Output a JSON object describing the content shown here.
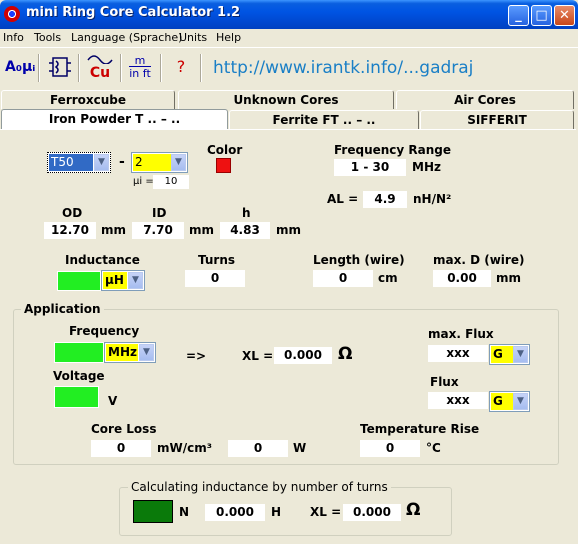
{
  "window": {
    "title": "mini Ring Core Calculator 1.2",
    "min": "_",
    "max": "□",
    "close": "✕"
  },
  "menu": [
    "Info",
    "Tools",
    "Language (Sprache)",
    "Units",
    "Help"
  ],
  "toolbar": {
    "btn1": "A₀μᵢ",
    "btn3": "Cu",
    "btn4_top": "m",
    "btn4_bottom": "in ft",
    "btn5": "?",
    "url": "http://www.irantk.info/...gadraj"
  },
  "tabs_row1": [
    "Ferroxcube",
    "Unknown Cores",
    "Air Cores"
  ],
  "tabs_row2": [
    "Iron Powder T .. – ..",
    "Ferrite FT .. – ..",
    "SIFFERIT"
  ],
  "core": {
    "size_value": "T50",
    "dash": "-",
    "material_value": "2",
    "mu_label": "µi =",
    "mu_value": "10",
    "color_label": "Color",
    "color": "#ee1111",
    "freq_range_label": "Frequency Range",
    "freq_range_value": "1 - 30",
    "freq_range_unit": "MHz",
    "al_label": "AL =",
    "al_value": "4.9",
    "al_unit": "nH/N²",
    "od_label": "OD",
    "od_value": "12.70",
    "od_unit": "mm",
    "id_label": "ID",
    "id_value": "7.70",
    "id_unit": "mm",
    "h_label": "h",
    "h_value": "4.83",
    "h_unit": "mm"
  },
  "winding": {
    "inductance_label": "Inductance",
    "inductance_unit": "µH",
    "turns_label": "Turns",
    "turns_value": "0",
    "length_label": "Length (wire)",
    "length_value": "0",
    "length_unit": "cm",
    "maxd_label": "max. D (wire)",
    "maxd_value": "0.00",
    "maxd_unit": "mm"
  },
  "application": {
    "title": "Application",
    "frequency_label": "Frequency",
    "frequency_unit": "MHz",
    "arrow": "=>",
    "xl_label": "XL =",
    "xl_value": "0.000",
    "ohm": "Ω",
    "voltage_label": "Voltage",
    "voltage_unit": "V",
    "maxflux_label": "max. Flux",
    "maxflux_value": "xxx",
    "maxflux_unit": "G",
    "flux_label": "Flux",
    "flux_value": "xxx",
    "flux_unit": "G",
    "coreloss_label": "Core Loss",
    "coreloss_value": "0",
    "coreloss_unit": "mW/cm³",
    "power_value": "0",
    "power_unit": "W",
    "temprise_label": "Temperature Rise",
    "temprise_value": "0",
    "temprise_unit": "°C"
  },
  "calc": {
    "title": "Calculating inductance by number of turns",
    "n_label": "N",
    "h_value": "0.000",
    "h_unit": "H",
    "xl_label": "XL =",
    "xl_value": "0.000",
    "ohm": "Ω"
  }
}
